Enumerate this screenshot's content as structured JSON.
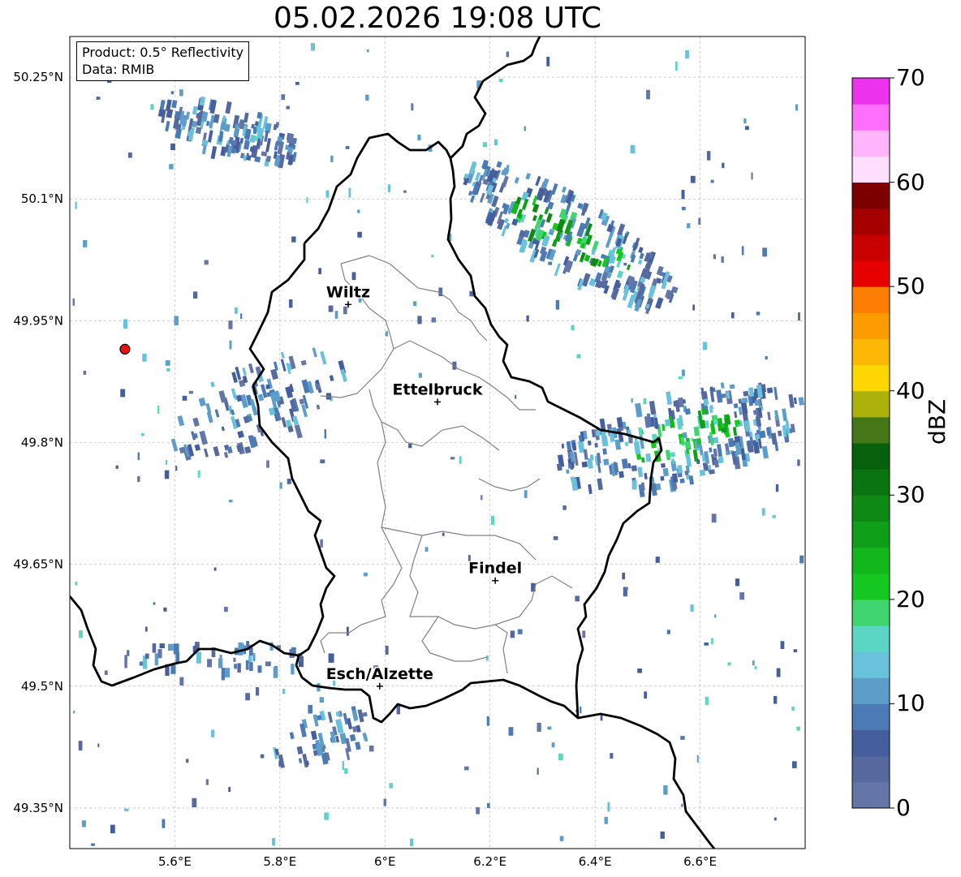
{
  "title": "05.02.2026 19:08 UTC",
  "info_box": {
    "product": "Product: 0.5° Reflectivity",
    "data": "Data: RMIB"
  },
  "axes": {
    "lon_ticks": [
      {
        "value": 5.6,
        "label": "5.6°E"
      },
      {
        "value": 5.8,
        "label": "5.8°E"
      },
      {
        "value": 6.0,
        "label": "6°E"
      },
      {
        "value": 6.2,
        "label": "6.2°E"
      },
      {
        "value": 6.4,
        "label": "6.4°E"
      },
      {
        "value": 6.6,
        "label": "6.6°E"
      }
    ],
    "lat_ticks": [
      {
        "value": 50.25,
        "label": "50.25°N"
      },
      {
        "value": 50.1,
        "label": "50.1°N"
      },
      {
        "value": 49.95,
        "label": "49.95°N"
      },
      {
        "value": 49.8,
        "label": "49.8°N"
      },
      {
        "value": 49.65,
        "label": "49.65°N"
      },
      {
        "value": 49.5,
        "label": "49.5°N"
      },
      {
        "value": 49.35,
        "label": "49.35°N"
      }
    ],
    "lon_range": [
      5.4,
      6.8
    ],
    "lat_range": [
      49.3,
      50.3
    ],
    "grid": true
  },
  "places": [
    {
      "name": "Wiltz",
      "lon": 5.93,
      "lat": 49.97
    },
    {
      "name": "Ettelbruck",
      "lon": 6.1,
      "lat": 49.85
    },
    {
      "name": "Findel",
      "lon": 6.21,
      "lat": 49.63
    },
    {
      "name": "Esch/Alzette",
      "lon": 5.99,
      "lat": 49.5
    }
  ],
  "radar_site": {
    "lon": 5.505,
    "lat": 49.915,
    "color": "#e8120c"
  },
  "colorbar": {
    "label": "dBZ",
    "min": 0,
    "max": 70,
    "step": 2.5,
    "tick_labels": [
      {
        "value": 0,
        "label": "0"
      },
      {
        "value": 10,
        "label": "10"
      },
      {
        "value": 20,
        "label": "20"
      },
      {
        "value": 30,
        "label": "30"
      },
      {
        "value": 40,
        "label": "40"
      },
      {
        "value": 50,
        "label": "50"
      },
      {
        "value": 60,
        "label": "60"
      },
      {
        "value": 70,
        "label": "70"
      }
    ],
    "colors": [
      "#6476a8",
      "#56699f",
      "#455e9d",
      "#4b7ab4",
      "#5c9ec9",
      "#68c2dc",
      "#5cd6c4",
      "#3fd56f",
      "#14c821",
      "#11b71b",
      "#0f9e18",
      "#0e8a14",
      "#0a7510",
      "#07600c",
      "#457718",
      "#adb20a",
      "#fdd603",
      "#fdb707",
      "#fd9c02",
      "#fd7e02",
      "#e60000",
      "#c80000",
      "#a50000",
      "#7d0000",
      "#ffdefe",
      "#ffb5fc",
      "#ff6ffc",
      "#ec32ec"
    ]
  },
  "echoes": [
    {
      "lon": 6.56,
      "lat": 49.81,
      "rx": 0.24,
      "ry": 0.055,
      "rot": -14,
      "n": 360,
      "peak": 8,
      "core": 0.5
    },
    {
      "lon": 6.35,
      "lat": 50.06,
      "rx": 0.24,
      "ry": 0.045,
      "rot": 32,
      "n": 320,
      "peak": 9,
      "core": 0.55
    },
    {
      "lon": 5.7,
      "lat": 50.19,
      "rx": 0.14,
      "ry": 0.03,
      "rot": 18,
      "n": 150,
      "peak": 3,
      "core": 0.35
    },
    {
      "lon": 5.75,
      "lat": 49.85,
      "rx": 0.18,
      "ry": 0.05,
      "rot": -25,
      "n": 130,
      "peak": 2,
      "core": 0.25
    },
    {
      "lon": 5.88,
      "lat": 49.44,
      "rx": 0.1,
      "ry": 0.03,
      "rot": -20,
      "n": 60,
      "peak": 2,
      "core": 0.25
    },
    {
      "lon": 5.7,
      "lat": 49.54,
      "rx": 0.2,
      "ry": 0.018,
      "rot": 0,
      "n": 60,
      "peak": 2,
      "core": 0.2
    }
  ]
}
